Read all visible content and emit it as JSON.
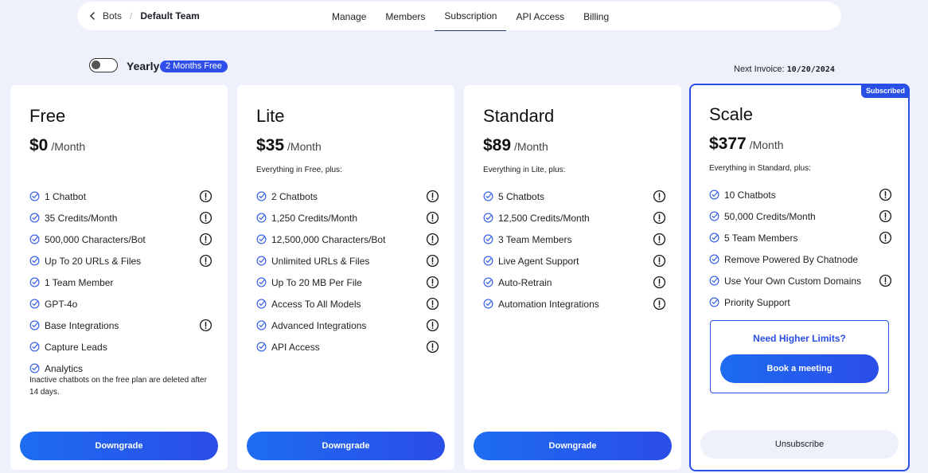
{
  "breadcrumb": {
    "back": "Bots",
    "separator": "/",
    "current": "Default Team"
  },
  "tabs": [
    {
      "label": "Manage"
    },
    {
      "label": "Members"
    },
    {
      "label": "Subscription",
      "active": true
    },
    {
      "label": "API Access"
    },
    {
      "label": "Billing"
    }
  ],
  "billing": {
    "yearly_label": "Yearly",
    "promo": "2 Months Free",
    "toggle_on": false
  },
  "invoice": {
    "label": "Next Invoice:",
    "date": "10/20/2024"
  },
  "colors": {
    "accent": "#2a4fe6",
    "gradient_start": "#1d6cf2",
    "background": "#eef1fb"
  },
  "icons": {
    "feature": "check-circle-icon",
    "info": "info-circle-icon",
    "back": "chevron-left-icon"
  },
  "plans": [
    {
      "name": "Free",
      "price": "$0",
      "per": "/Month",
      "plus": "",
      "features": [
        {
          "text": "1 Chatbot",
          "info": true
        },
        {
          "text": "35 Credits/Month",
          "info": true
        },
        {
          "text": "500,000 Characters/Bot",
          "info": true
        },
        {
          "text": "Up To 20 URLs & Files",
          "info": true
        },
        {
          "text": "1 Team Member",
          "info": false
        },
        {
          "text": "GPT-4o",
          "info": false
        },
        {
          "text": "Base Integrations",
          "info": true
        },
        {
          "text": "Capture Leads",
          "info": false
        },
        {
          "text": "Analytics",
          "info": false
        }
      ],
      "note": "Inactive chatbots on the free plan are deleted after 14 days.",
      "button": "Downgrade"
    },
    {
      "name": "Lite",
      "price": "$35",
      "per": "/Month",
      "plus": "Everything in Free, plus:",
      "features": [
        {
          "text": "2 Chatbots",
          "info": true
        },
        {
          "text": "1,250 Credits/Month",
          "info": true
        },
        {
          "text": "12,500,000 Characters/Bot",
          "info": true
        },
        {
          "text": "Unlimited URLs & Files",
          "info": true
        },
        {
          "text": "Up To 20 MB Per File",
          "info": true
        },
        {
          "text": "Access To All Models",
          "info": true
        },
        {
          "text": "Advanced Integrations",
          "info": true
        },
        {
          "text": "API Access",
          "info": true
        }
      ],
      "note": "",
      "button": "Downgrade"
    },
    {
      "name": "Standard",
      "price": "$89",
      "per": "/Month",
      "plus": "Everything in Lite, plus:",
      "features": [
        {
          "text": "5 Chatbots",
          "info": true
        },
        {
          "text": "12,500 Credits/Month",
          "info": true
        },
        {
          "text": "3 Team Members",
          "info": true
        },
        {
          "text": "Live Agent Support",
          "info": true
        },
        {
          "text": "Auto-Retrain",
          "info": true
        },
        {
          "text": "Automation Integrations",
          "info": true
        }
      ],
      "note": "",
      "button": "Downgrade"
    },
    {
      "name": "Scale",
      "price": "$377",
      "per": "/Month",
      "plus": "Everything in Standard, plus:",
      "badge": "Subscribed",
      "features": [
        {
          "text": "10 Chatbots",
          "info": true
        },
        {
          "text": "50,000 Credits/Month",
          "info": true
        },
        {
          "text": "5 Team Members",
          "info": true
        },
        {
          "text": "Remove Powered By Chatnode",
          "info": false
        },
        {
          "text": "Use Your Own Custom Domains",
          "info": true
        },
        {
          "text": "Priority Support",
          "info": false
        }
      ],
      "note": "",
      "higher_limits": {
        "title": "Need Higher Limits?",
        "button": "Book a meeting"
      },
      "button": "Unsubscribe"
    }
  ]
}
